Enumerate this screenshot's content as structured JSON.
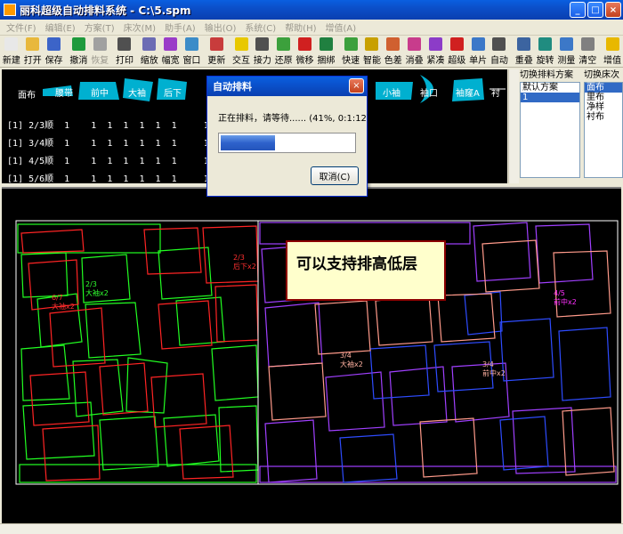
{
  "window": {
    "title": "丽科超级自动排料系统 - C:\\5.spm"
  },
  "menu": [
    "文件(F)",
    "编辑(E)",
    "方案(T)",
    "床次(M)",
    "助手(A)",
    "输出(O)",
    "系统(C)",
    "帮助(H)",
    "增值(A)"
  ],
  "toolbar": [
    {
      "label": "新建",
      "icon": "new-file-icon",
      "color": "#E8E8E8",
      "group": 1
    },
    {
      "label": "打开",
      "icon": "open-folder-icon",
      "color": "#E8B83C",
      "group": 1
    },
    {
      "label": "保存",
      "icon": "save-disk-icon",
      "color": "#3C64C8",
      "group": 1
    },
    {
      "label": "撤消",
      "icon": "undo-icon",
      "color": "#1E9A3C",
      "group": 2
    },
    {
      "label": "恢复",
      "icon": "redo-icon",
      "color": "#A0A0A0",
      "group": 2,
      "disabled": true
    },
    {
      "label": "打印",
      "icon": "printer-icon",
      "color": "#505050",
      "group": 3
    },
    {
      "label": "缩放",
      "icon": "zoom-icon",
      "color": "#6C6CB4",
      "group": 4
    },
    {
      "label": "幅宽",
      "icon": "width-icon",
      "color": "#9A3CC8",
      "group": 4
    },
    {
      "label": "窗口",
      "icon": "window-icon",
      "color": "#3C8CC8",
      "group": 4
    },
    {
      "label": "更新",
      "icon": "refresh-icon",
      "color": "#C83C3C",
      "group": 5
    },
    {
      "label": "交互",
      "icon": "cursor-icon",
      "color": "#E8C800",
      "group": 6
    },
    {
      "label": "接力",
      "icon": "relay-icon",
      "color": "#505050",
      "group": 6
    },
    {
      "label": "还原",
      "icon": "restore-icon",
      "color": "#3CA03C",
      "group": 6
    },
    {
      "label": "微移",
      "icon": "nudge-icon",
      "color": "#D02020",
      "group": 6
    },
    {
      "label": "捆绑",
      "icon": "bind-icon",
      "color": "#208040",
      "group": 6
    },
    {
      "label": "快速",
      "icon": "fast-icon",
      "color": "#3CA03C",
      "group": 7
    },
    {
      "label": "智能",
      "icon": "smart-icon",
      "color": "#C8A000",
      "group": 7
    },
    {
      "label": "色差",
      "icon": "color-diff-icon",
      "color": "#D06030",
      "group": 7
    },
    {
      "label": "消叠",
      "icon": "unoverlap-icon",
      "color": "#C83C8C",
      "group": 7
    },
    {
      "label": "紧凑",
      "icon": "compact-icon",
      "color": "#8C3CC8",
      "group": 7
    },
    {
      "label": "超级",
      "icon": "super-icon",
      "color": "#D02020",
      "group": 7
    },
    {
      "label": "单片",
      "icon": "single-piece-icon",
      "color": "#3C78C8",
      "group": 7
    },
    {
      "label": "自动",
      "icon": "auto-icon",
      "color": "#505050",
      "group": 7
    },
    {
      "label": "重叠",
      "icon": "overlap-icon",
      "color": "#3C64A0",
      "group": 8
    },
    {
      "label": "旋转",
      "icon": "rotate-icon",
      "color": "#208C80",
      "group": 8
    },
    {
      "label": "测量",
      "icon": "measure-icon",
      "color": "#3C78C8",
      "group": 8
    },
    {
      "label": "清空",
      "icon": "clear-icon",
      "color": "#808080",
      "group": 8
    },
    {
      "label": "增值",
      "icon": "value-add-icon",
      "color": "#E8B800",
      "group": 9
    }
  ],
  "pieces": {
    "header_label": "面布",
    "tags": [
      "腰带",
      "前中",
      "大袖",
      "后下",
      "小袖",
      "袖口",
      "袖窿A",
      "衬"
    ],
    "rows": [
      "[1] 2/3顺  1    1  1  1  1  1  1     1  1   1  1     2  2  1",
      "[1] 3/4顺  1    1  1  1  1  1  1     1  1   1  1     2  2  1",
      "[1] 4/5顺  1    1  1  1  1  1  1     1  1   1  1     2  2  1",
      "[1] 5/6顺  1    1  1  1  1  1  1     1  1   1  1     2  2  1"
    ]
  },
  "side": {
    "scheme_header": "切换排料方案",
    "schemes": [
      "默认方案",
      "1"
    ],
    "schemes_selected": 1,
    "bed_header": "切换床次",
    "beds": [
      "面布",
      "里布",
      "净样",
      "衬布"
    ],
    "beds_selected": 0
  },
  "dialog": {
    "title": "自动排料",
    "message": "正在排料，请等待......  (41%, 0:1:12)",
    "progress": 0.41,
    "cancel_label": "取消(C)"
  },
  "note": {
    "text": "可以支持排高低层"
  },
  "board": {
    "labels": [
      {
        "t": "6/7\n大袖x2",
        "c": "#FF3030"
      },
      {
        "t": "2/3\n大袖x2",
        "c": "#30FF30"
      },
      {
        "t": "3/4\n大袖x2",
        "c": "#FFB0A0"
      },
      {
        "t": "4/5\n前中x2",
        "c": "#FF30FF"
      },
      {
        "t": "3/4\n前中x2",
        "c": "#FFB0A0"
      },
      {
        "t": "2/3\n后下x2",
        "c": "#FF3030"
      }
    ]
  }
}
